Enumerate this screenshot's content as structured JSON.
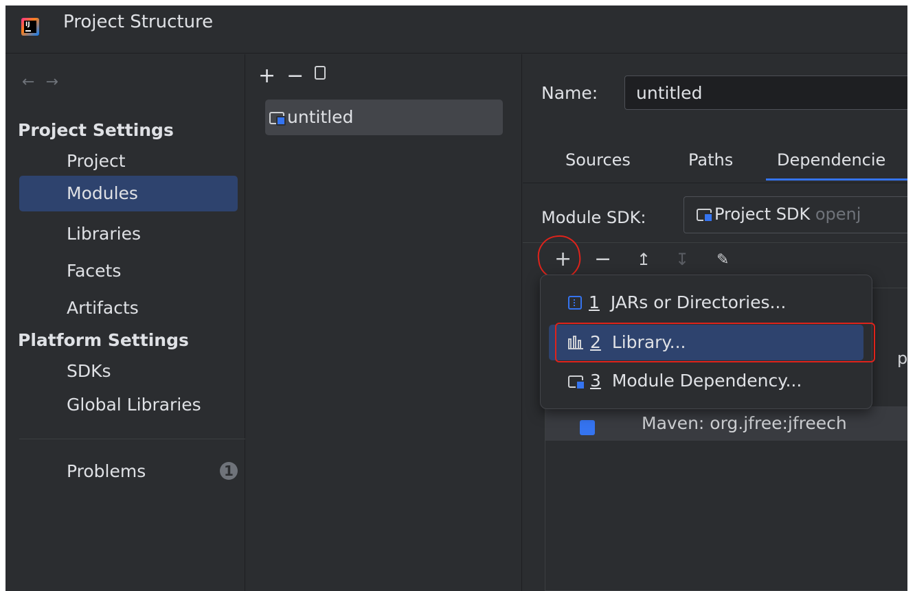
{
  "window": {
    "title": "Project Structure",
    "app_icon": "intellij-idea-icon"
  },
  "nav": {
    "back_icon": "arrow-left-icon",
    "forward_icon": "arrow-right-icon",
    "project_settings_header": "Project Settings",
    "project_settings_items": [
      "Project",
      "Modules",
      "Libraries",
      "Facets",
      "Artifacts"
    ],
    "platform_settings_header": "Platform Settings",
    "platform_settings_items": [
      "SDKs",
      "Global Libraries"
    ],
    "problems_label": "Problems",
    "problems_count": "1",
    "selected": "Modules"
  },
  "modules_panel": {
    "toolbar": {
      "add_icon": "plus-icon",
      "remove_icon": "minus-icon",
      "copy_icon": "copy-icon"
    },
    "modules": [
      "untitled"
    ]
  },
  "module_detail": {
    "name_label": "Name:",
    "name_value": "untitled",
    "tabs": [
      "Sources",
      "Paths",
      "Dependencie"
    ],
    "active_tab": "Dependencie",
    "sdk_label": "Module SDK:",
    "sdk_value": "Project SDK",
    "sdk_suffix": "openj",
    "dep_toolbar": [
      "plus-icon",
      "minus-icon",
      "move-up-icon",
      "move-down-icon",
      "edit-icon"
    ],
    "hidden_row_text": "Maven: org.jfree:jfreech",
    "peek_text": "pe"
  },
  "add_popup": {
    "items": [
      {
        "num": "1",
        "label": "JARs or Directories...",
        "icon": "jar-directory-icon"
      },
      {
        "num": "2",
        "label": "Library...",
        "icon": "library-icon"
      },
      {
        "num": "3",
        "label": "Module Dependency...",
        "icon": "module-icon"
      }
    ],
    "selected_index": 1
  },
  "colors": {
    "background": "#2b2d30",
    "selection": "#2e436e",
    "accent": "#3574f0",
    "annotation": "#e0231b"
  }
}
